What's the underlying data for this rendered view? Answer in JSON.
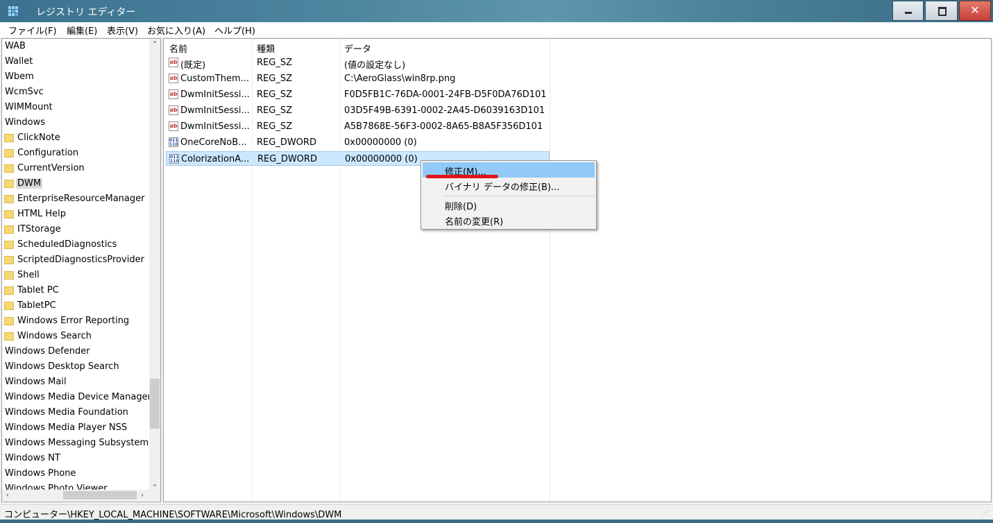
{
  "window": {
    "title": "レジストリ エディター",
    "close_glyph": "✕"
  },
  "menu": {
    "items": [
      "ファイル(F)",
      "編集(E)",
      "表示(V)",
      "お気に入り(A)",
      "ヘルプ(H)"
    ]
  },
  "tree": {
    "items": [
      {
        "label": "WAB",
        "folder": false
      },
      {
        "label": "Wallet",
        "folder": false
      },
      {
        "label": "Wbem",
        "folder": false
      },
      {
        "label": "WcmSvc",
        "folder": false
      },
      {
        "label": "WIMMount",
        "folder": false
      },
      {
        "label": "Windows",
        "folder": false
      },
      {
        "label": "ClickNote",
        "folder": true
      },
      {
        "label": "Configuration",
        "folder": true
      },
      {
        "label": "CurrentVersion",
        "folder": true
      },
      {
        "label": "DWM",
        "folder": true,
        "selected": true
      },
      {
        "label": "EnterpriseResourceManager",
        "folder": true
      },
      {
        "label": "HTML Help",
        "folder": true
      },
      {
        "label": "ITStorage",
        "folder": true
      },
      {
        "label": "ScheduledDiagnostics",
        "folder": true
      },
      {
        "label": "ScriptedDiagnosticsProvider",
        "folder": true
      },
      {
        "label": "Shell",
        "folder": true
      },
      {
        "label": "Tablet PC",
        "folder": true
      },
      {
        "label": "TabletPC",
        "folder": true
      },
      {
        "label": "Windows Error Reporting",
        "folder": true
      },
      {
        "label": "Windows Search",
        "folder": true
      },
      {
        "label": "Windows Defender",
        "folder": false
      },
      {
        "label": "Windows Desktop Search",
        "folder": false
      },
      {
        "label": "Windows Mail",
        "folder": false
      },
      {
        "label": "Windows Media Device Manager",
        "folder": false
      },
      {
        "label": "Windows Media Foundation",
        "folder": false
      },
      {
        "label": "Windows Media Player NSS",
        "folder": false
      },
      {
        "label": "Windows Messaging Subsystem",
        "folder": false
      },
      {
        "label": "Windows NT",
        "folder": false
      },
      {
        "label": "Windows Phone",
        "folder": false
      },
      {
        "label": "Windows Photo Viewer",
        "folder": false
      }
    ],
    "scroll_up": "⌃",
    "scroll_down": "⌄",
    "scroll_left": "‹",
    "scroll_right": "›"
  },
  "list": {
    "headers": {
      "name": "名前",
      "type": "種類",
      "data": "データ"
    },
    "rows": [
      {
        "icon": "string-value-icon",
        "name": "(既定)",
        "type": "REG_SZ",
        "data": "(値の設定なし)"
      },
      {
        "icon": "string-value-icon",
        "name": "CustomThem...",
        "type": "REG_SZ",
        "data": "C:\\AeroGlass\\win8rp.png"
      },
      {
        "icon": "string-value-icon",
        "name": "DwmInitSessi...",
        "type": "REG_SZ",
        "data": "F0D5FB1C-76DA-0001-24FB-D5F0DA76D101"
      },
      {
        "icon": "string-value-icon",
        "name": "DwmInitSessi...",
        "type": "REG_SZ",
        "data": "03D5F49B-6391-0002-2A45-D6039163D101"
      },
      {
        "icon": "string-value-icon",
        "name": "DwmInitSessi...",
        "type": "REG_SZ",
        "data": "A5B7868E-56F3-0002-8A65-B8A5F356D101"
      },
      {
        "icon": "dword-value-icon",
        "name": "OneCoreNoB...",
        "type": "REG_DWORD",
        "data": "0x00000000 (0)"
      },
      {
        "icon": "dword-value-icon",
        "name": "ColorizationA...",
        "type": "REG_DWORD",
        "data": "0x00000000 (0)",
        "selected": true
      }
    ],
    "sz_icon_text": "ab",
    "dword_icon_text": "011 110"
  },
  "context_menu": {
    "items": [
      {
        "label": "修正(M)...",
        "highlight": true
      },
      {
        "label": "バイナリ データの修正(B)..."
      },
      {
        "label": "削除(D)"
      },
      {
        "label": "名前の変更(R)"
      }
    ]
  },
  "status": {
    "path": "コンピューター\\HKEY_LOCAL_MACHINE\\SOFTWARE\\Microsoft\\Windows\\DWM"
  },
  "colors": {
    "selection": "#cce8ff",
    "menu_highlight": "#91c9f7",
    "annotation": "#e01414"
  }
}
